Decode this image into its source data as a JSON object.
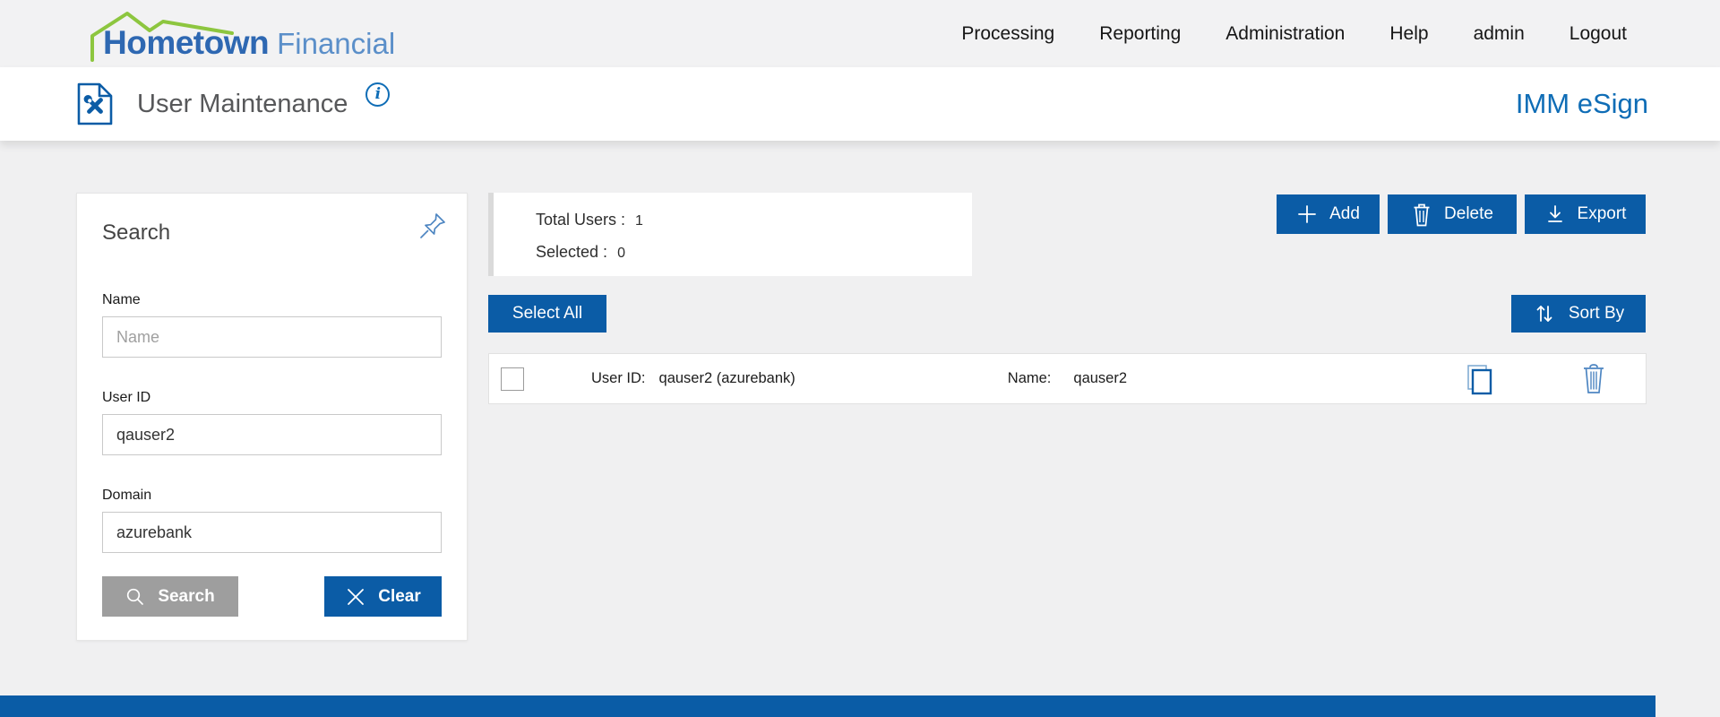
{
  "nav": {
    "logo": {
      "bold": "Hometown",
      "light": "Financial"
    },
    "items": [
      {
        "label": "Processing"
      },
      {
        "label": "Reporting"
      },
      {
        "label": "Administration"
      },
      {
        "label": "Help"
      },
      {
        "label": "admin"
      },
      {
        "label": "Logout"
      }
    ]
  },
  "header": {
    "title": "User Maintenance",
    "info_glyph": "i",
    "product": "IMM eSign"
  },
  "search_panel": {
    "title": "Search",
    "name_label": "Name",
    "name_placeholder": "Name",
    "user_id_label": "User ID",
    "user_id_value": "qauser2",
    "domain_label": "Domain",
    "domain_value": "azurebank",
    "search_button": "Search",
    "clear_button": "Clear"
  },
  "summary": {
    "total_label": "Total Users :",
    "total_value": "1",
    "selected_label": "Selected :",
    "selected_value": "0"
  },
  "toolbar": {
    "add": "Add",
    "delete": "Delete",
    "export": "Export"
  },
  "list_controls": {
    "select_all": "Select All",
    "sort_by": "Sort By"
  },
  "user_row": {
    "user_id_label": "User ID:",
    "user_id_value": "qauser2 (azurebank)",
    "name_label": "Name:",
    "name_value": "qauser2"
  },
  "colors": {
    "primary_blue": "#0b5ca6",
    "esign_blue": "#0f6db6",
    "logo_blue": "#2e68b2",
    "logo_light_blue": "#5b8fc9",
    "logo_green": "#8dc63f",
    "search_button_gray": "#9e9e9e",
    "footer_blue": "#0a5ca6"
  }
}
